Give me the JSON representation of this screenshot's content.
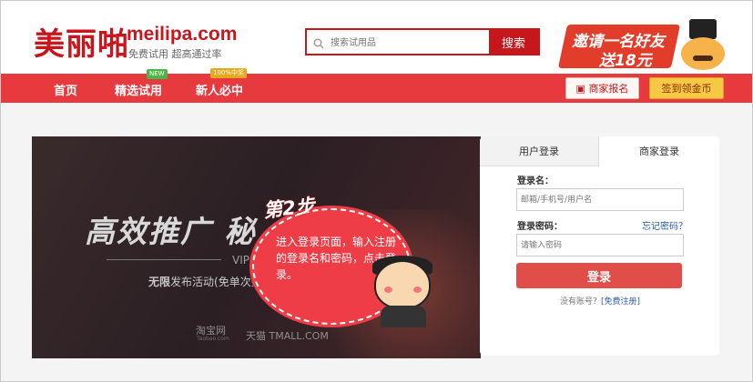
{
  "header": {
    "brand_cn": "美丽啪",
    "brand_en": "meilipa.com",
    "slogan": "免费试用 超高通过率",
    "search": {
      "placeholder": "搜索试用品",
      "button_label": "搜索"
    },
    "promo": {
      "line1": "邀请一名好友",
      "line2": "送18元"
    }
  },
  "nav": {
    "items": [
      {
        "label": "首页"
      },
      {
        "label": "精选试用",
        "badge": "NEW"
      },
      {
        "label": "新人必中",
        "badge": "100%中奖"
      }
    ],
    "merchant_button": "商家报名",
    "signin_button": "签到领金币"
  },
  "banner": {
    "headline": "高效推广 秘",
    "headline_tail": "!",
    "subtitle": "VIP专",
    "desc_bold": "无限",
    "desc_rest": "发布活动(免单次数",
    "logos": {
      "taobao": "淘宝网",
      "taobao_en": "Taobao.com",
      "tmall": "天猫 TMALL.COM"
    }
  },
  "step": {
    "title": "第2步",
    "text": "进入登录页面，输入注册的登录名和密码，点击登录。"
  },
  "login": {
    "tabs": [
      "用户登录",
      "商家登录"
    ],
    "active_tab": "商家登录",
    "username_label": "登录名：",
    "username_placeholder": "邮箱/手机号/用户名",
    "password_label": "登录密码：",
    "forgot_link": "忘记密码？",
    "password_placeholder": "请输入密码",
    "submit_label": "登录",
    "no_account_text": "没有账号？",
    "register_link": "[免费注册]"
  },
  "colors": {
    "brand_red": "#c8161d",
    "nav_red": "#e63a3f",
    "login_button": "#e14e4a",
    "link_blue": "#2a5da6",
    "gold_button": "#f6c843",
    "overlay": "rgba(0,0,0,0.05)"
  }
}
